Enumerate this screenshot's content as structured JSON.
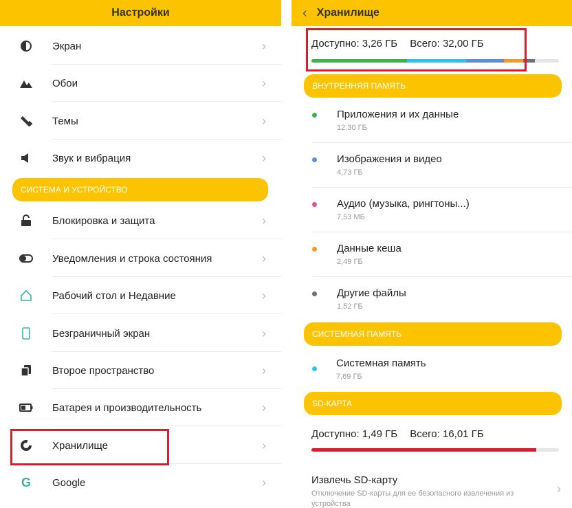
{
  "colors": {
    "accent": "#fcc400",
    "highlight": "#d81e2c",
    "apps": "#3bb34a",
    "images": "#5b8fd6",
    "audio": "#e8508a",
    "cache": "#f39a2b",
    "other": "#6c6f7a",
    "system": "#2ec3e6",
    "sd_used": "#d81e2c"
  },
  "left": {
    "title": "Настройки",
    "items_top": [
      {
        "label": "Экран",
        "icon": "display-icon"
      },
      {
        "label": "Обои",
        "icon": "wallpaper-icon"
      },
      {
        "label": "Темы",
        "icon": "themes-icon"
      },
      {
        "label": "Звук и вибрация",
        "icon": "sound-icon"
      }
    ],
    "section_system": "СИСТЕМА И УСТРОЙСТВО",
    "items_system": [
      {
        "label": "Блокировка и защита",
        "icon": "lock-icon"
      },
      {
        "label": "Уведомления и строка состояния",
        "icon": "toggle-icon"
      },
      {
        "label": "Рабочий стол и Недавние",
        "icon": "home-icon"
      },
      {
        "label": "Безграничный экран",
        "icon": "phone-icon"
      },
      {
        "label": "Второе пространство",
        "icon": "second-space-icon"
      },
      {
        "label": "Батарея и производительность",
        "icon": "battery-icon"
      },
      {
        "label": "Хранилище",
        "icon": "storage-icon"
      },
      {
        "label": "Google",
        "icon": "google-icon"
      }
    ]
  },
  "right": {
    "title": "Хранилище",
    "internal": {
      "available": "Доступно: 3,26 ГБ",
      "total": "Всего: 32,00 ГБ",
      "usage_fractions": {
        "apps": 0.385,
        "system": 0.24,
        "images": 0.148,
        "other": 0.048,
        "cache": 0.078,
        "other2": 0.0
      },
      "free_fraction": 0.102
    },
    "section_internal": "ВНУТРЕННЯЯ ПАМЯТЬ",
    "internal_items": [
      {
        "name": "Приложения и их данные",
        "size": "12,30 ГБ",
        "color": "#3bb34a"
      },
      {
        "name": "Изображения и видео",
        "size": "4,73 ГБ",
        "color": "#5b8fd6"
      },
      {
        "name": "Аудио (музыка, рингтоны...)",
        "size": "7,53 МБ",
        "color": "#e8508a"
      },
      {
        "name": "Данные кеша",
        "size": "2,49 ГБ",
        "color": "#f39a2b"
      },
      {
        "name": "Другие файлы",
        "size": "1,52 ГБ",
        "color": "#6c6f7a"
      }
    ],
    "section_system": "СИСТЕМНАЯ ПАМЯТЬ",
    "system_item": {
      "name": "Системная память",
      "size": "7,69 ГБ",
      "color": "#2ec3e6"
    },
    "section_sd": "SD-КАРТА",
    "sd": {
      "available": "Доступно: 1,49 ГБ",
      "total": "Всего: 16,01 ГБ",
      "used_fraction": 0.907
    },
    "eject": {
      "title": "Извлечь SD-карту",
      "desc": "Отключение SD-карты для ее безопасного извлечения из устройства"
    }
  }
}
